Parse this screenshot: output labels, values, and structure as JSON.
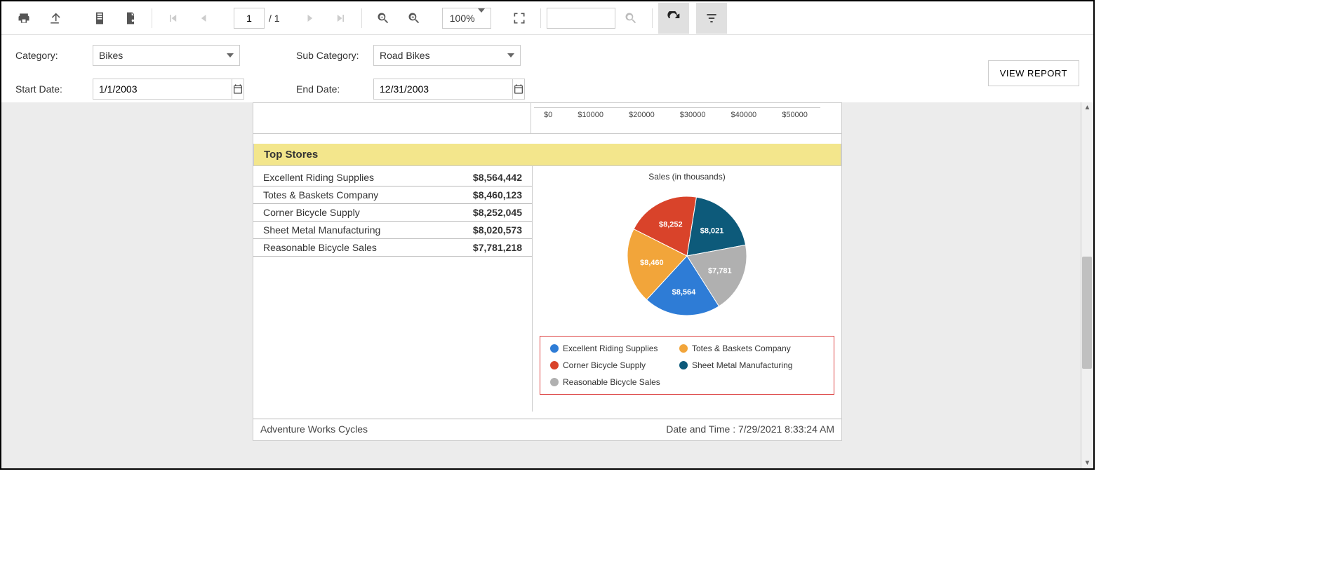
{
  "toolbar": {
    "page_current": "1",
    "page_total": "/ 1",
    "zoom": "100%"
  },
  "params": {
    "category_label": "Category:",
    "category_value": "Bikes",
    "subcategory_label": "Sub Category:",
    "subcategory_value": "Road Bikes",
    "startdate_label": "Start Date:",
    "startdate_value": "1/1/2003",
    "enddate_label": "End Date:",
    "enddate_value": "12/31/2003",
    "view_report": "VIEW REPORT"
  },
  "axis_ticks": [
    "$0",
    "$10000",
    "$20000",
    "$30000",
    "$40000",
    "$50000"
  ],
  "top_stores_header": "Top Stores",
  "stores": [
    {
      "name": "Excellent Riding Supplies",
      "value": "$8,564,442"
    },
    {
      "name": "Totes & Baskets Company",
      "value": "$8,460,123"
    },
    {
      "name": "Corner Bicycle Supply",
      "value": "$8,252,045"
    },
    {
      "name": "Sheet Metal Manufacturing",
      "value": "$8,020,573"
    },
    {
      "name": "Reasonable Bicycle Sales",
      "value": "$7,781,218"
    }
  ],
  "chart_data": {
    "type": "pie",
    "title": "Sales (in thousands)",
    "series": [
      {
        "name": "Excellent Riding Supplies",
        "value": 8564,
        "label": "$8,564",
        "color": "#2e7cd6"
      },
      {
        "name": "Totes & Baskets Company",
        "value": 8460,
        "label": "$8,460",
        "color": "#f2a53a"
      },
      {
        "name": "Corner Bicycle Supply",
        "value": 8252,
        "label": "$8,252",
        "color": "#d9432a"
      },
      {
        "name": "Sheet Metal Manufacturing",
        "value": 8021,
        "label": "$8,021",
        "color": "#0d5a7a"
      },
      {
        "name": "Reasonable Bicycle Sales",
        "value": 7781,
        "label": "$7,781",
        "color": "#b0b0b0"
      }
    ]
  },
  "footer": {
    "company": "Adventure Works Cycles",
    "datetime": "Date and Time : 7/29/2021 8:33:24 AM"
  }
}
